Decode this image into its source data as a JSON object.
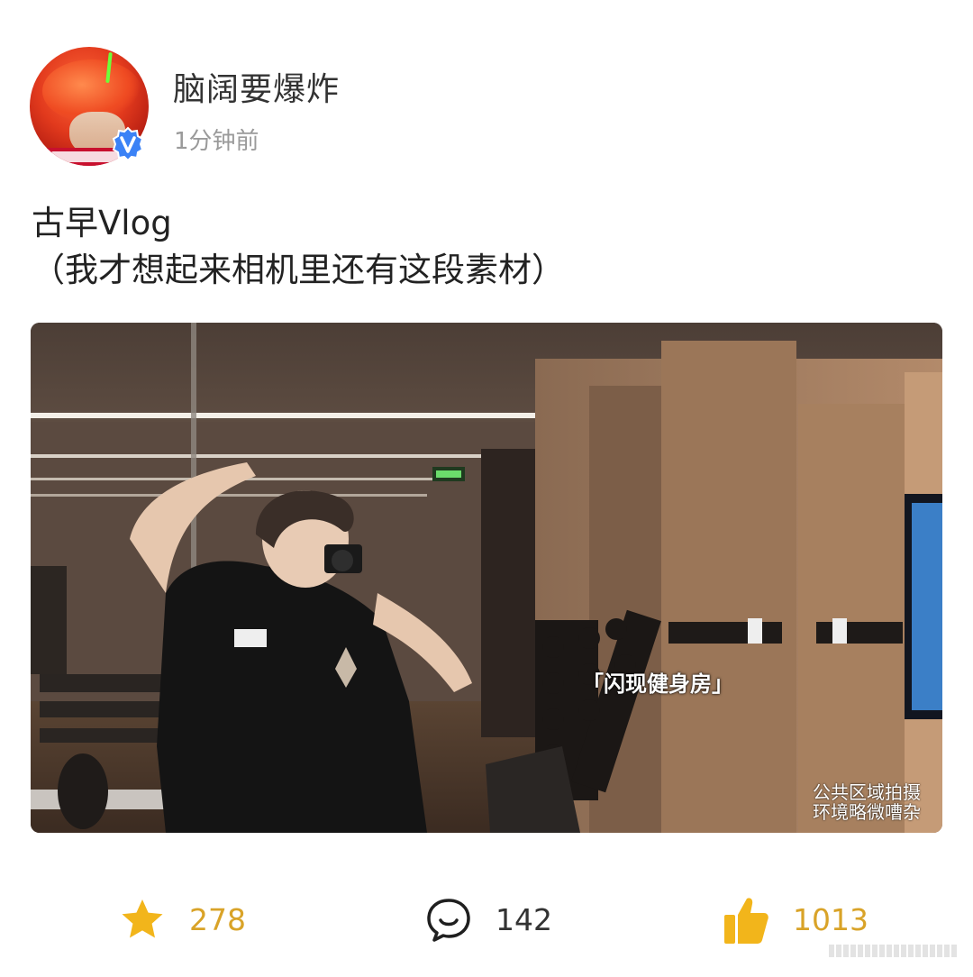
{
  "user": {
    "name": "脑阔要爆炸",
    "time": "1分钟前",
    "verified_badge_icon": "verified-v-icon"
  },
  "post": {
    "line1": "古早Vlog",
    "line2": "（我才想起来相机里还有这段素材）"
  },
  "media": {
    "subtitle": "「闪现健身房」",
    "notice_line1": "公共区域拍摄",
    "notice_line2": "环境略微嘈杂"
  },
  "actions": {
    "favorite": {
      "icon": "star-icon",
      "count": "278"
    },
    "comment": {
      "icon": "comment-icon",
      "count": "142"
    },
    "like": {
      "icon": "thumbs-up-icon",
      "count": "1013"
    }
  },
  "colors": {
    "accent": "#d9a328",
    "badge_blue": "#3b82f6",
    "username": "#333333",
    "timestamp": "#9a9a9a"
  }
}
